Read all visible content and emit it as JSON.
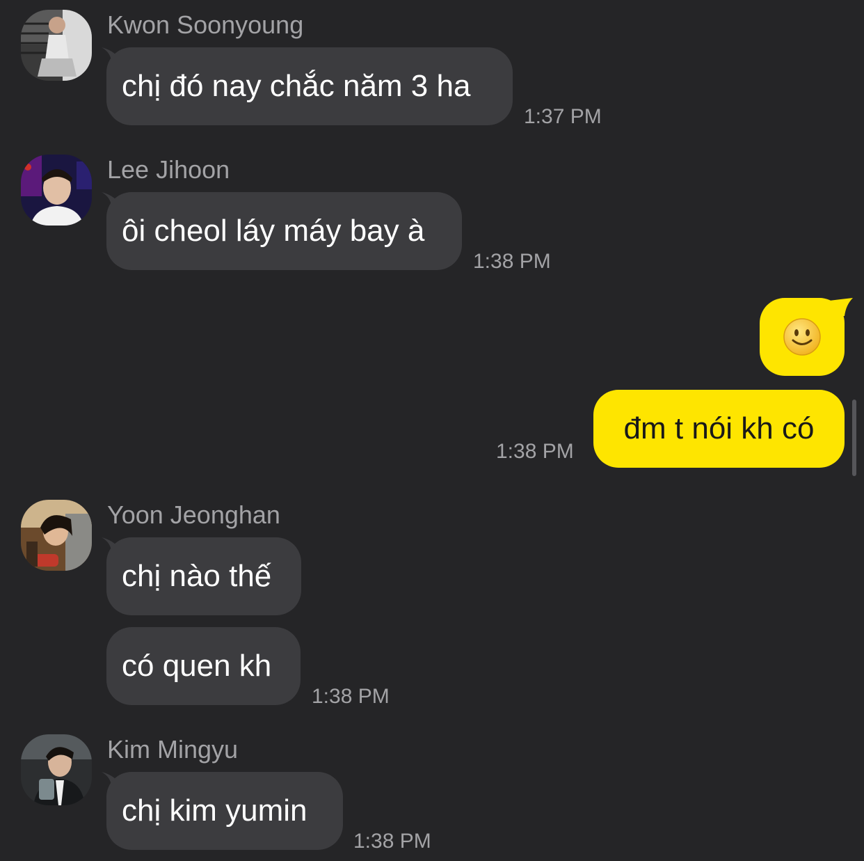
{
  "messages": [
    {
      "sender": "Kwon Soonyoung",
      "text": "chị đó nay chắc năm 3 ha",
      "time": "1:37 PM",
      "avatar": "avatar-kwon-soonyoung"
    },
    {
      "sender": "Lee Jihoon",
      "text": "ôi cheol láy máy bay à",
      "time": "1:38 PM",
      "avatar": "avatar-lee-jihoon"
    },
    {
      "sender": "me",
      "emoji": "🙂",
      "icon": "slightly-smiling-face-icon"
    },
    {
      "sender": "me",
      "text": "đm t nói kh có",
      "time": "1:38 PM"
    },
    {
      "sender": "Yoon Jeonghan",
      "text": "chị nào thế",
      "avatar": "avatar-yoon-jeonghan"
    },
    {
      "sender": "Yoon Jeonghan",
      "text": "có quen kh",
      "time": "1:38 PM"
    },
    {
      "sender": "Kim Mingyu",
      "text": "chị kim yumin",
      "time": "1:38 PM",
      "avatar": "avatar-kim-mingyu"
    }
  ],
  "colors": {
    "background": "#252527",
    "incoming_bubble": "#3c3c3f",
    "outgoing_bubble": "#fee500",
    "secondary_text": "#a3a3a6"
  }
}
